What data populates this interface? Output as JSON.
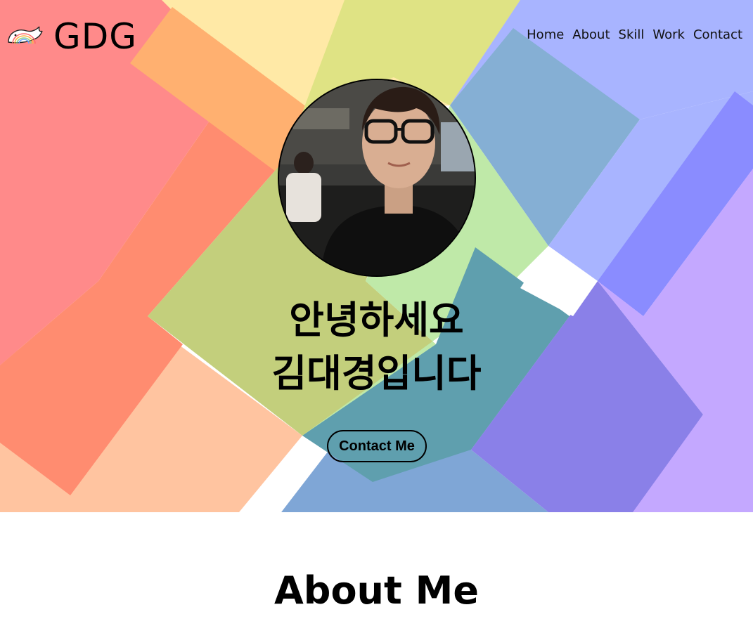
{
  "navbar": {
    "logo_text": "GDG",
    "logo_icon": "rainbow-whale-icon",
    "menu": [
      {
        "label": "Home"
      },
      {
        "label": "About"
      },
      {
        "label": "Skill"
      },
      {
        "label": "Work"
      },
      {
        "label": "Contact"
      }
    ]
  },
  "hero": {
    "avatar_icon": "profile-photo",
    "title_line1": "안녕하세요",
    "title_line2": "김대경입니다",
    "contact_button": "Contact Me",
    "background_colors": [
      "#ff8a8a",
      "#ffc2a0",
      "#ffe9a6",
      "#dfe384",
      "#bfe9a8",
      "#7fa6d6",
      "#a8b4ff",
      "#8a8aff",
      "#c4a8ff"
    ]
  },
  "about": {
    "title": "About Me"
  }
}
